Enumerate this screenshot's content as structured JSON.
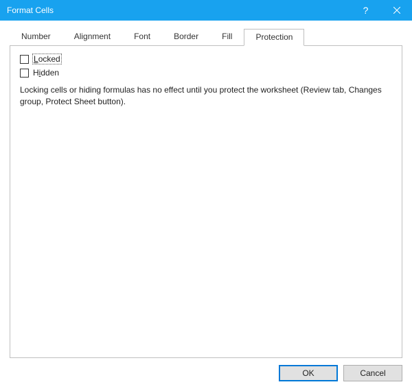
{
  "titlebar": {
    "title": "Format Cells",
    "help_tooltip": "?",
    "close_tooltip": "Close"
  },
  "tabs": {
    "number": "Number",
    "alignment": "Alignment",
    "font": "Font",
    "border": "Border",
    "fill": "Fill",
    "protection": "Protection"
  },
  "protection_tab": {
    "locked_prefix": "L",
    "locked_rest": "ocked",
    "hidden_prefix": "H",
    "hidden_underline": "i",
    "hidden_rest": "dden",
    "description": "Locking cells or hiding formulas has no effect until you protect the worksheet (Review tab, Changes group, Protect Sheet button)."
  },
  "buttons": {
    "ok": "OK",
    "cancel": "Cancel"
  }
}
